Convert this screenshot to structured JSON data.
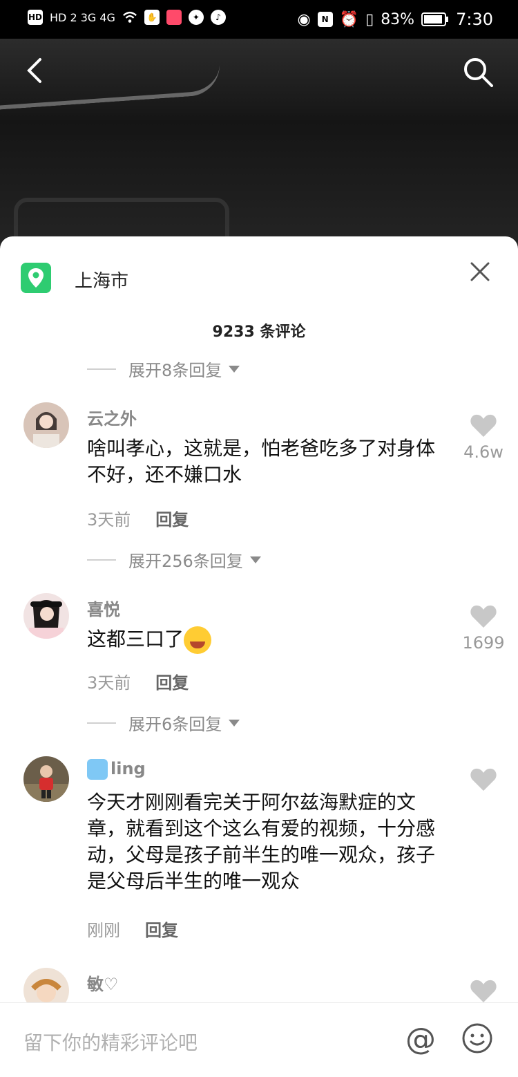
{
  "status_bar": {
    "network_left": "HD 2  3G  4G",
    "battery_percent": "83%",
    "time": "7:30"
  },
  "header": {
    "back_icon": "chevron-left-icon",
    "search_icon": "search-icon"
  },
  "sheet": {
    "location": "上海市",
    "close_icon": "close-icon",
    "comment_count": "9233 条评论",
    "expand_top": "展开8条回复",
    "comments": [
      {
        "user": "云之外",
        "text": "啥叫孝心，这就是，怕老爸吃多了对身体不好，还不嫌口水",
        "time": "3天前",
        "reply": "回复",
        "likes": "4.6w",
        "expand": "展开256条回复"
      },
      {
        "user": "喜悦",
        "text": "这都三口了",
        "time": "3天前",
        "reply": "回复",
        "likes": "1699",
        "expand": "展开6条回复"
      },
      {
        "user": "ling",
        "text": "今天才刚刚看完关于阿尔兹海默症的文章，就看到这个这么有爱的视频，十分感动，父母是孩子前半生的唯一观众，孩子是父母后半生的唯一观众",
        "time": "刚刚",
        "reply": "回复",
        "likes": ""
      },
      {
        "user": "敏♡"
      }
    ]
  },
  "input_bar": {
    "placeholder": "留下你的精彩评论吧",
    "at_label": "@",
    "emoji_icon": "smiley-icon"
  },
  "colors": {
    "location_green": "#2ecc71",
    "like_gray": "#c8c8c8"
  }
}
